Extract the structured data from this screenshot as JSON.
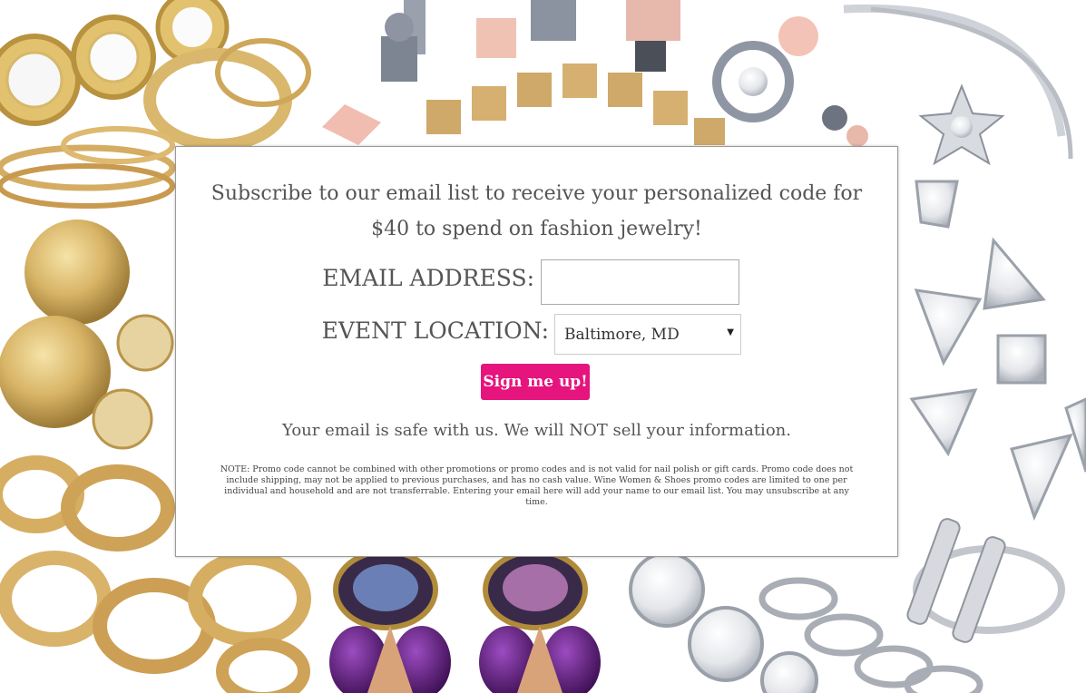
{
  "form": {
    "headline": "Subscribe to our email list to receive your personalized code for $40 to spend on fashion jewelry!",
    "email_label": "EMAIL ADDRESS:",
    "email_value": "",
    "location_label": "EVENT LOCATION:",
    "location_selected": "Baltimore, MD",
    "submit_label": "Sign me up!",
    "privacy_text": "Your email is safe with us. We will NOT sell your information.",
    "note": "NOTE: Promo code cannot be combined with other promotions or promo codes and is not valid for nail polish or gift cards. Promo code does not include shipping, may not be applied to previous purchases, and has no cash value. Wine Women & Shoes promo codes are limited to one per individual and household and are not transferrable. Entering your email here will add your name to our email list. You may unsubscribe at any time."
  },
  "colors": {
    "accent": "#e6147d",
    "text": "#555555",
    "gold": "#c9a45a",
    "silver": "#c8c8c8",
    "purple": "#5a1f6e"
  },
  "icons": {
    "select_arrow": "caret-down-icon"
  }
}
